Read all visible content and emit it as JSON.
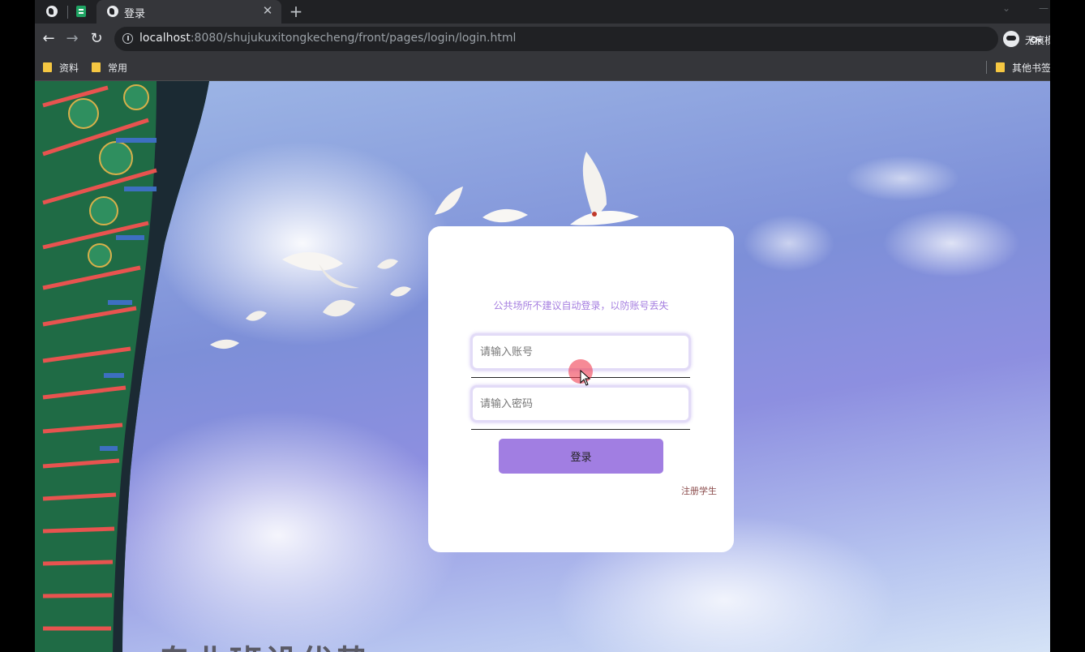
{
  "browser": {
    "tabs": {
      "active_title": "登录"
    },
    "url": {
      "host": "localhost",
      "path": ":8080/shujukuxitongkecheng/front/pages/login/login.html"
    },
    "profile_name": "无痕模",
    "bookmarks": [
      "资料",
      "常用"
    ],
    "other_bookmarks": "其他书签"
  },
  "login": {
    "notice": "公共场所不建议自动登录，以防账号丢失",
    "account_placeholder": "请输入账号",
    "password_placeholder": "请输入密码",
    "login_button": "登录",
    "register_link": "注册学生"
  },
  "background": {
    "bottom_text": "专业班设优势"
  },
  "colors": {
    "accent": "#a17ee2",
    "notice_text": "#a67fe0",
    "register_text": "#8a4a4a"
  }
}
